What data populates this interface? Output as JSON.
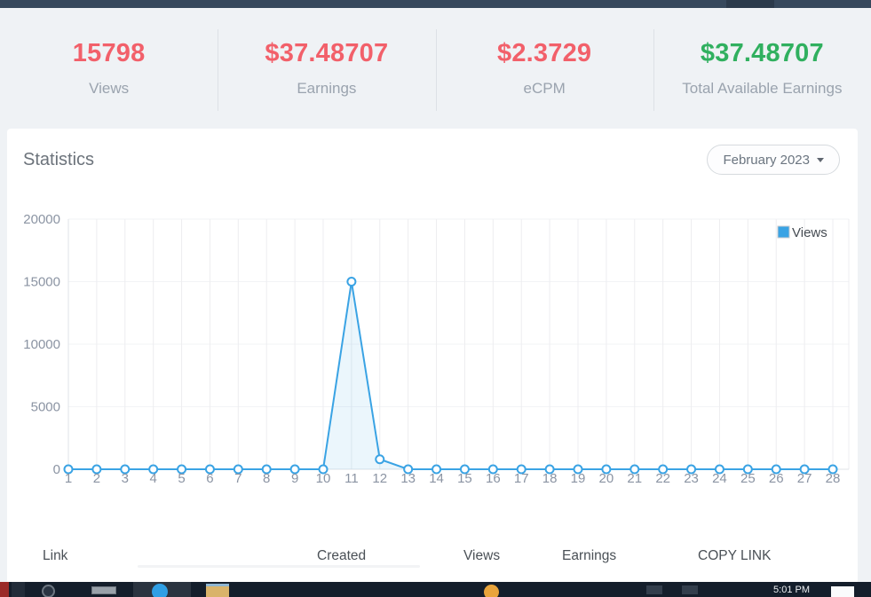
{
  "stats": [
    {
      "value": "15798",
      "label": "Views",
      "color": "#f2606a"
    },
    {
      "value": "$37.48707",
      "label": "Earnings",
      "color": "#f2606a"
    },
    {
      "value": "$2.3729",
      "label": "eCPM",
      "color": "#f2606a"
    },
    {
      "value": "$37.48707",
      "label": "Total Available Earnings",
      "color": "#30b05f"
    }
  ],
  "statistics_card": {
    "title": "Statistics",
    "period_label": "February 2023"
  },
  "chart_data": {
    "type": "line",
    "title": "",
    "xlabel": "",
    "ylabel": "",
    "x": [
      1,
      2,
      3,
      4,
      5,
      6,
      7,
      8,
      9,
      10,
      11,
      12,
      13,
      14,
      15,
      16,
      17,
      18,
      19,
      20,
      21,
      22,
      23,
      24,
      25,
      26,
      27,
      28
    ],
    "series": [
      {
        "name": "Views",
        "values": [
          0,
          0,
          0,
          0,
          0,
          0,
          0,
          0,
          0,
          0,
          15000,
          798,
          0,
          0,
          0,
          0,
          0,
          0,
          0,
          0,
          0,
          0,
          0,
          0,
          0,
          0,
          0,
          0
        ]
      }
    ],
    "ylim": [
      0,
      20000
    ],
    "yticks": [
      0,
      5000,
      10000,
      15000,
      20000
    ],
    "grid": true,
    "legend_position": "top-right",
    "line_color": "#3aa3e4",
    "area_fill": "rgba(58,163,228,0.10)",
    "marker": {
      "fill": "#ffffff",
      "stroke": "#3aa3e4",
      "radius": 4.5
    }
  },
  "link_table": {
    "headers": [
      "Link",
      "Created",
      "Views",
      "Earnings",
      "COPY LINK"
    ]
  },
  "taskbar": {
    "clock": "5:01 PM",
    "icons": [
      "red-app-icon",
      "logo-circle-icon",
      "window-app-icon",
      "blue-circle-app-icon",
      "folder-icon",
      "orange-circle-app-icon",
      "tray-icon",
      "tray-icon",
      "notification-rect"
    ]
  },
  "colors": {
    "topbar": "#36485c",
    "card_background": "#ffffff",
    "page_background": "#eff2f5"
  }
}
